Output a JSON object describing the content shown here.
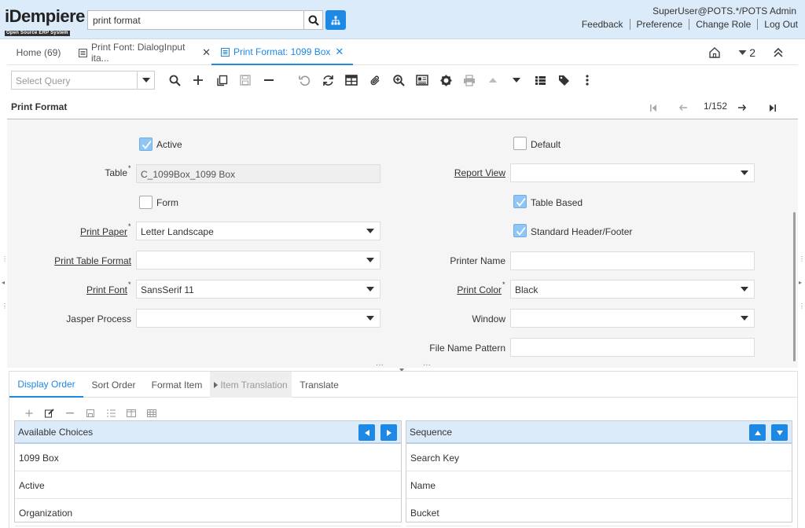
{
  "app": {
    "logo_text": "iDempiere",
    "logo_subtext": "Open Source ERP System",
    "search_value": "print format",
    "user": "SuperUser@POTS.*/POTS Admin",
    "links": [
      "Feedback",
      "Preference",
      "Change Role",
      "Log Out"
    ]
  },
  "tabs": [
    {
      "label": "Home (69)",
      "closable": false,
      "active": false
    },
    {
      "label": "Print Font: DialogInput ita...",
      "closable": true,
      "active": false
    },
    {
      "label": "Print Format: 1099 Box",
      "closable": true,
      "active": true
    }
  ],
  "tabbar_right": {
    "window_count": "2"
  },
  "toolbar": {
    "query_placeholder": "Select Query",
    "icons": [
      "search-icon",
      "new-record-icon",
      "copy-record-icon",
      "save-icon",
      "delete-icon",
      "undo-icon",
      "refresh-icon",
      "grid-toggle-icon",
      "attachment-icon",
      "zoom-icon",
      "report-icon",
      "process-icon",
      "print-icon",
      "previous-record-icon",
      "next-record-icon",
      "detail-list-icon",
      "tag-icon",
      "more-icon"
    ]
  },
  "titlebar": {
    "title": "Print Format",
    "record_count": "1/152"
  },
  "form": {
    "active_label": "Active",
    "active": true,
    "default_label": "Default",
    "default": false,
    "table_label": "Table",
    "table_value": "C_1099Box_1099 Box",
    "report_view_label": "Report View",
    "report_view_value": "",
    "form_label": "Form",
    "form": false,
    "table_based_label": "Table Based",
    "table_based": true,
    "print_paper_label": "Print Paper",
    "print_paper_value": "Letter Landscape",
    "std_header_label": "Standard Header/Footer",
    "std_header": true,
    "print_table_format_label": "Print Table Format",
    "print_table_format_value": "",
    "printer_name_label": "Printer Name",
    "printer_name_value": "",
    "print_font_label": "Print Font",
    "print_font_value": "SansSerif 11",
    "print_color_label": "Print Color",
    "print_color_value": "Black",
    "jasper_process_label": "Jasper Process",
    "jasper_process_value": "",
    "window_label": "Window",
    "window_value": "",
    "file_name_pattern_label": "File Name Pattern",
    "file_name_pattern_value": ""
  },
  "detail_tabs": [
    {
      "label": "Display Order",
      "active": true
    },
    {
      "label": "Sort Order",
      "active": false
    },
    {
      "label": "Format Item",
      "active": false
    },
    {
      "label": "Item Translation",
      "active": false,
      "disabled": true
    },
    {
      "label": "Translate",
      "active": false
    }
  ],
  "available_choices": {
    "header": "Available Choices",
    "items": [
      "1099 Box",
      "Active",
      "Organization"
    ]
  },
  "sequence": {
    "header": "Sequence",
    "items": [
      "Search Key",
      "Name",
      "Bucket"
    ]
  },
  "colors": {
    "accent": "#1e88e5",
    "header_bg": "#dcebfa",
    "form_bg": "#f5f5f5"
  }
}
